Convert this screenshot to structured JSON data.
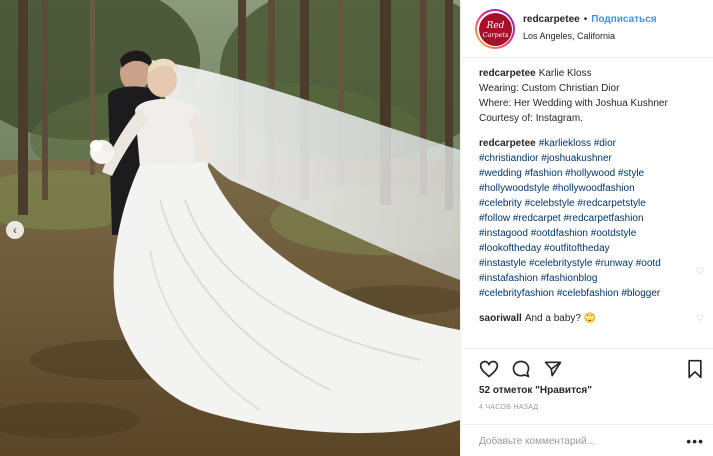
{
  "post": {
    "username": "redcarpetee",
    "follow_label": "Подписаться",
    "dot": "•",
    "location": "Los Angeles, California",
    "avatar_text_1": "Red",
    "avatar_text_2": "Carpets"
  },
  "caption": {
    "username": "redcarpetee",
    "lines": [
      "Karlie Kloss",
      "Wearing: Custom Christian Dior",
      "Where: Her Wedding with Joshua Kushner",
      "Courtesy of: Instagram."
    ]
  },
  "hashtag_comment": {
    "username": "redcarpetee",
    "lines": [
      "#karliekloss #dior",
      "#christiandior #joshuakushner",
      "#wedding #fashion #hollywood #style",
      "#hollywoodstyle #hollywoodfashion",
      "#celebrity #celebstyle #redcarpetstyle",
      "#follow #redcarpet #redcarpetfashion",
      "#instagood #ootdfashion #ootdstyle",
      "#lookoftheday #outfitoftheday",
      "#instastyle #celebritystyle #runway #ootd",
      "#instafashion #fashionblog",
      "#celebrityfashion #celebfashion #blogger"
    ]
  },
  "reply": {
    "username": "saoriwall",
    "text": "And a baby? 🙄"
  },
  "stats": {
    "likes": "52 отметок \"Нравится\"",
    "time": "4 ЧАСОВ НАЗАД"
  },
  "add_comment": {
    "placeholder": "Добавьте комментарий..."
  },
  "icons": {
    "heart": "heart-icon",
    "comment": "comment-icon",
    "share": "share-icon",
    "bookmark": "bookmark-icon",
    "more": "more-icon",
    "prev": "chevron-left-icon"
  },
  "symbols": {
    "prev": "‹",
    "more": "•••",
    "heart_small": "♡"
  },
  "colors": {
    "link": "#3897f0",
    "hashtag": "#003569",
    "muted": "#999999"
  }
}
